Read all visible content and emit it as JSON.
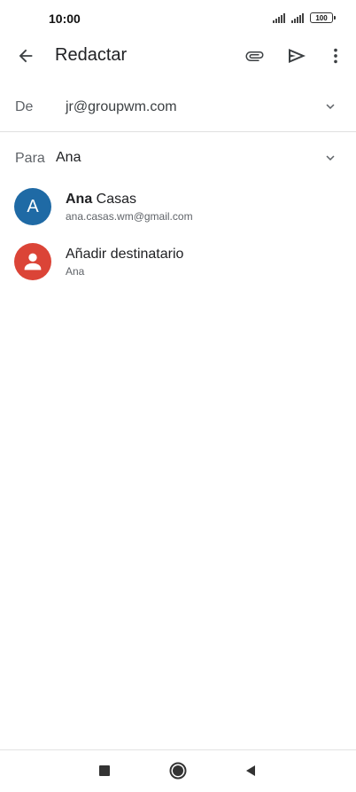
{
  "status_bar": {
    "time": "10:00",
    "battery": "100"
  },
  "toolbar": {
    "title": "Redactar",
    "icons": [
      "back-arrow-icon",
      "paperclip-icon",
      "send-icon",
      "more-vert-icon"
    ]
  },
  "from": {
    "label": "De",
    "value": "jr@groupwm.com"
  },
  "to": {
    "label": "Para",
    "value": "Ana"
  },
  "suggestions": [
    {
      "avatar_letter": "A",
      "name_bold": "Ana",
      "name_rest": " Casas",
      "email": "ana.casas.wm@gmail.com",
      "avatar_color": "#1f6aa5"
    },
    {
      "title": "Añadir destinatario",
      "subtitle": "Ana",
      "avatar_color": "#db4437"
    }
  ],
  "nav_bar": {
    "icons": [
      "recent-apps-icon",
      "home-icon",
      "back-triangle-icon"
    ]
  }
}
